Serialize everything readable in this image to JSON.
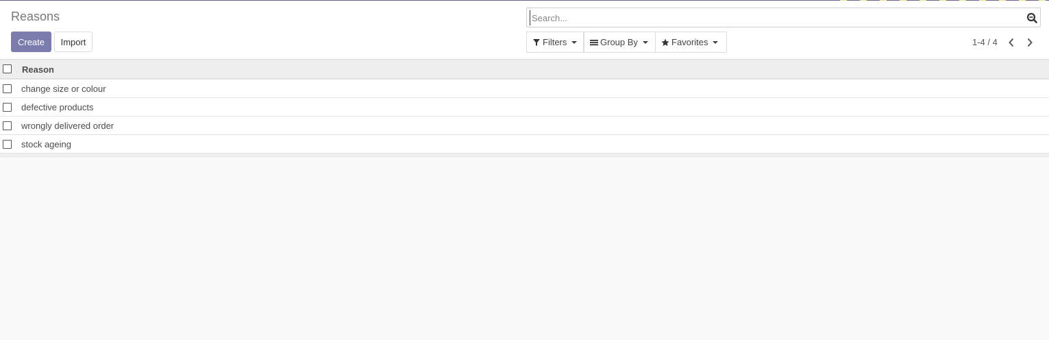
{
  "page": {
    "title": "Reasons"
  },
  "actions": {
    "create_label": "Create",
    "import_label": "Import"
  },
  "search": {
    "placeholder": "Search...",
    "value": ""
  },
  "search_options": {
    "filters_label": "Filters",
    "group_by_label": "Group By",
    "favorites_label": "Favorites"
  },
  "pager": {
    "value": "1-4 / 4"
  },
  "table": {
    "columns": [
      "Reason"
    ],
    "rows": [
      {
        "reason": "change size or colour"
      },
      {
        "reason": "defective products"
      },
      {
        "reason": "wrongly delivered order"
      },
      {
        "reason": "stock ageing"
      }
    ]
  },
  "colors": {
    "primary": "#7c7bad",
    "header_bg": "#eeeeee",
    "page_bg": "#f9f9f9"
  },
  "icons": {
    "search": "search-icon",
    "filter": "filter-icon",
    "group_by": "list-icon",
    "favorites": "star-icon",
    "pager_prev": "chevron-left-icon",
    "pager_next": "chevron-right-icon"
  }
}
